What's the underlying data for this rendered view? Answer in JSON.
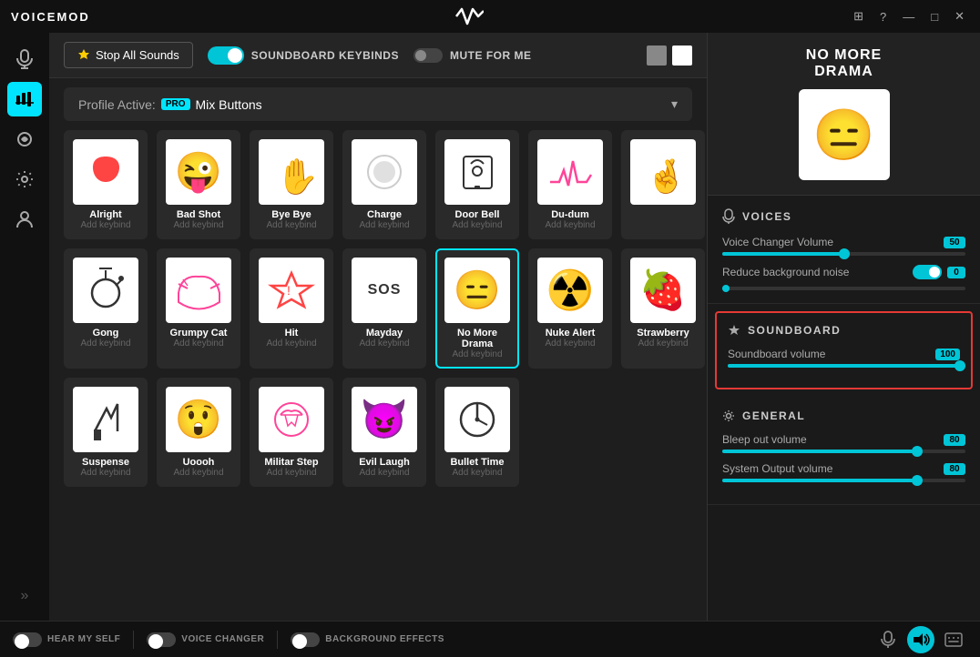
{
  "titlebar": {
    "logo": "VOICEMOD",
    "center_logo": "VM",
    "controls": [
      "monitor-icon",
      "question-icon",
      "minimize-icon",
      "maximize-icon",
      "close-icon"
    ]
  },
  "sidebar": {
    "icons": [
      {
        "name": "microphone-icon",
        "active": false
      },
      {
        "name": "soundboard-icon",
        "active": true
      },
      {
        "name": "effects-icon",
        "active": false
      },
      {
        "name": "settings-icon",
        "active": false
      },
      {
        "name": "user-icon",
        "active": false
      }
    ],
    "expand_label": "»"
  },
  "toolbar": {
    "stop_sounds_label": "Stop All Sounds",
    "soundboard_keybinds_label": "SOUNDBOARD KEYBINDS",
    "mute_for_me_label": "MUTE FOR ME"
  },
  "profile": {
    "label_prefix": "Profile Active:",
    "pro_badge": "PRO",
    "profile_name": "Mix Buttons"
  },
  "sounds": [
    {
      "name": "Alright",
      "keybind": "Add keybind",
      "emoji": "❤️",
      "bg": "#fff",
      "active": false
    },
    {
      "name": "Bad Shot",
      "keybind": "Add keybind",
      "emoji": "😜",
      "bg": "#fff",
      "active": false
    },
    {
      "name": "Bye Bye",
      "keybind": "Add keybind",
      "emoji": "✋",
      "bg": "#fff",
      "active": false
    },
    {
      "name": "Charge",
      "keybind": "Add keybind",
      "emoji": "⚾",
      "bg": "#fff",
      "active": false
    },
    {
      "name": "Door Bell",
      "keybind": "Add keybind",
      "emoji": "🔔",
      "bg": "#fff",
      "active": false
    },
    {
      "name": "Du-dum",
      "keybind": "Add keybind",
      "emoji": "📈",
      "bg": "#fff",
      "active": false
    },
    {
      "name": "",
      "keybind": "",
      "emoji": "🤞",
      "bg": "#fff",
      "active": false
    },
    {
      "name": "Gong",
      "keybind": "Add keybind",
      "emoji": "🔔",
      "bg": "#fff",
      "active": false
    },
    {
      "name": "Grumpy Cat",
      "keybind": "Add keybind",
      "emoji": "😾",
      "bg": "#fff",
      "active": false
    },
    {
      "name": "Hit",
      "keybind": "Add keybind",
      "emoji": "⚠️",
      "bg": "#fff",
      "active": false
    },
    {
      "name": "Mayday",
      "keybind": "Add keybind",
      "emoji": "SOS",
      "bg": "#fff",
      "active": false
    },
    {
      "name": "No More Drama",
      "keybind": "Add keybind",
      "emoji": "😑",
      "bg": "#fff",
      "active": true
    },
    {
      "name": "Nuke Alert",
      "keybind": "Add keybind",
      "emoji": "☢️",
      "bg": "#fff",
      "active": false
    },
    {
      "name": "Strawberry",
      "keybind": "Add keybind",
      "emoji": "🍓",
      "bg": "#fff",
      "active": false
    },
    {
      "name": "Suspense",
      "keybind": "Add keybind",
      "emoji": "🔨",
      "bg": "#fff",
      "active": false
    },
    {
      "name": "Uoooh",
      "keybind": "Add keybind",
      "emoji": "😲",
      "bg": "#fff",
      "active": false
    },
    {
      "name": "Militar Step",
      "keybind": "Add keybind",
      "emoji": "🥁",
      "bg": "#fff",
      "active": false
    },
    {
      "name": "Evil Laugh",
      "keybind": "Add keybind",
      "emoji": "😈",
      "bg": "#fff",
      "active": false
    },
    {
      "name": "Bullet Time",
      "keybind": "Add keybind",
      "emoji": "🕐",
      "bg": "#fff",
      "active": false
    }
  ],
  "featured": {
    "title": "NO MORE\nDRAMA",
    "emoji": "😑"
  },
  "voices_section": {
    "title": "VOICES",
    "voice_changer_volume_label": "Voice Changer Volume",
    "voice_changer_volume_value": "50",
    "voice_changer_volume_pct": 50,
    "reduce_bg_noise_label": "Reduce background noise",
    "reduce_bg_noise_value": "0",
    "reduce_bg_noise_on": true
  },
  "soundboard_section": {
    "title": "SOUNDBOARD",
    "volume_label": "Soundboard volume",
    "volume_value": "100",
    "volume_pct": 100
  },
  "general_section": {
    "title": "GENERAL",
    "bleep_label": "Bleep out volume",
    "bleep_value": "80",
    "bleep_pct": 80,
    "system_output_label": "System Output volume",
    "system_output_value": "80",
    "system_output_pct": 80
  },
  "bottom_bar": {
    "hear_myself_label": "HEAR MY SELF",
    "voice_changer_label": "VOICE CHANGER",
    "background_effects_label": "BACKGROUND EFFECTS"
  }
}
